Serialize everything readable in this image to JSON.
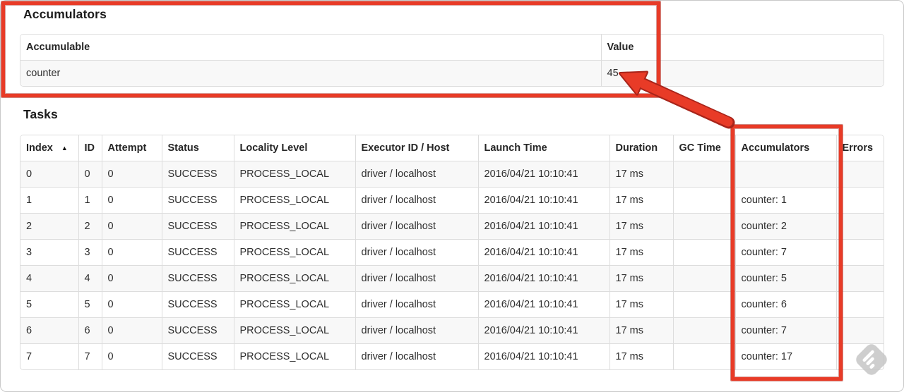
{
  "page": {
    "accumulators_section": {
      "title": "Accumulators",
      "table": {
        "columns": [
          {
            "label": "Accumulable"
          },
          {
            "label": "Value"
          }
        ],
        "rows": [
          [
            "counter",
            "45"
          ]
        ]
      }
    },
    "tasks_section": {
      "title": "Tasks",
      "table": {
        "columns": [
          {
            "label": "Index",
            "sort_icon": "▲"
          },
          {
            "label": "ID"
          },
          {
            "label": "Attempt"
          },
          {
            "label": "Status"
          },
          {
            "label": "Locality Level"
          },
          {
            "label": "Executor ID / Host"
          },
          {
            "label": "Launch Time"
          },
          {
            "label": "Duration"
          },
          {
            "label": "GC Time"
          },
          {
            "label": "Accumulators"
          },
          {
            "label": "Errors"
          }
        ],
        "rows": [
          [
            "0",
            "0",
            "0",
            "SUCCESS",
            "PROCESS_LOCAL",
            "driver / localhost",
            "2016/04/21 10:10:41",
            "17 ms",
            "",
            "",
            ""
          ],
          [
            "1",
            "1",
            "0",
            "SUCCESS",
            "PROCESS_LOCAL",
            "driver / localhost",
            "2016/04/21 10:10:41",
            "17 ms",
            "",
            "counter: 1",
            ""
          ],
          [
            "2",
            "2",
            "0",
            "SUCCESS",
            "PROCESS_LOCAL",
            "driver / localhost",
            "2016/04/21 10:10:41",
            "17 ms",
            "",
            "counter: 2",
            ""
          ],
          [
            "3",
            "3",
            "0",
            "SUCCESS",
            "PROCESS_LOCAL",
            "driver / localhost",
            "2016/04/21 10:10:41",
            "17 ms",
            "",
            "counter: 7",
            ""
          ],
          [
            "4",
            "4",
            "0",
            "SUCCESS",
            "PROCESS_LOCAL",
            "driver / localhost",
            "2016/04/21 10:10:41",
            "17 ms",
            "",
            "counter: 5",
            ""
          ],
          [
            "5",
            "5",
            "0",
            "SUCCESS",
            "PROCESS_LOCAL",
            "driver / localhost",
            "2016/04/21 10:10:41",
            "17 ms",
            "",
            "counter: 6",
            ""
          ],
          [
            "6",
            "6",
            "0",
            "SUCCESS",
            "PROCESS_LOCAL",
            "driver / localhost",
            "2016/04/21 10:10:41",
            "17 ms",
            "",
            "counter: 7",
            ""
          ],
          [
            "7",
            "7",
            "0",
            "SUCCESS",
            "PROCESS_LOCAL",
            "driver / localhost",
            "2016/04/21 10:10:41",
            "17 ms",
            "",
            "counter: 17",
            ""
          ]
        ]
      }
    },
    "annotations": {
      "color": "#e83b27",
      "outline_color": "#a8241a"
    },
    "watermark": {
      "icon": "stamp-icon",
      "color": "#c6c6c6"
    }
  }
}
